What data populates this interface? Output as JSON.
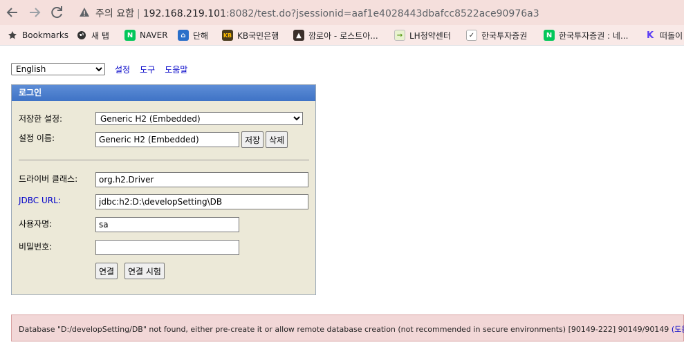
{
  "browser": {
    "security_label": "주의 요함",
    "url_host": "192.168.219.101",
    "url_rest": ":8082/test.do?jsessionid=aaf1e4028443dbafcc8522ace90976a3",
    "nav_icons": [
      "back-arrow-icon",
      "forward-arrow-icon",
      "reload-icon"
    ]
  },
  "bookmarks": [
    {
      "label": "Bookmarks",
      "icon": "star-icon"
    },
    {
      "label": "새 탭",
      "icon": "globe-icon"
    },
    {
      "label": "NAVER",
      "icon": "naver-icon"
    },
    {
      "label": "단해",
      "icon": "site-icon"
    },
    {
      "label": "KB국민은행",
      "icon": "kb-icon"
    },
    {
      "label": "깜로아 - 로스트아...",
      "icon": "cat-icon"
    },
    {
      "label": "LH청약센터",
      "icon": "lh-icon"
    },
    {
      "label": "한국투자증권",
      "icon": "stock-icon"
    },
    {
      "label": "한국투자증권 : 네...",
      "icon": "naver-icon"
    },
    {
      "label": "떠돌이",
      "icon": "k-icon"
    }
  ],
  "top": {
    "language": "English",
    "links": [
      "설정",
      "도구",
      "도움말"
    ]
  },
  "login": {
    "header": "로그인",
    "saved_settings_label": "저장한 설정:",
    "saved_settings_value": "Generic H2 (Embedded)",
    "setting_name_label": "설정 이름:",
    "setting_name_value": "Generic H2 (Embedded)",
    "save_button": "저장",
    "delete_button": "삭제",
    "driver_class_label": "드라이버 클래스:",
    "driver_class_value": "org.h2.Driver",
    "jdbc_url_label": "JDBC URL:",
    "jdbc_url_value": "jdbc:h2:D:\\developSetting\\DB",
    "username_label": "사용자명:",
    "username_value": "sa",
    "password_label": "비밀번호:",
    "password_value": "",
    "connect_button": "연결",
    "test_connection_button": "연결 시험"
  },
  "error": {
    "message": "Database \"D:/developSetting/DB\" not found, either pre-create it or allow remote database creation (not recommended in secure environments) [90149-222] 90149/90149",
    "help_link": "(도움말)"
  },
  "colors": {
    "tab_bar": "#f5dfdc",
    "login_header": "#3f73c6",
    "login_bg": "#ece9d8",
    "error_bg": "#f2d7d7",
    "link": "#0000c8"
  }
}
